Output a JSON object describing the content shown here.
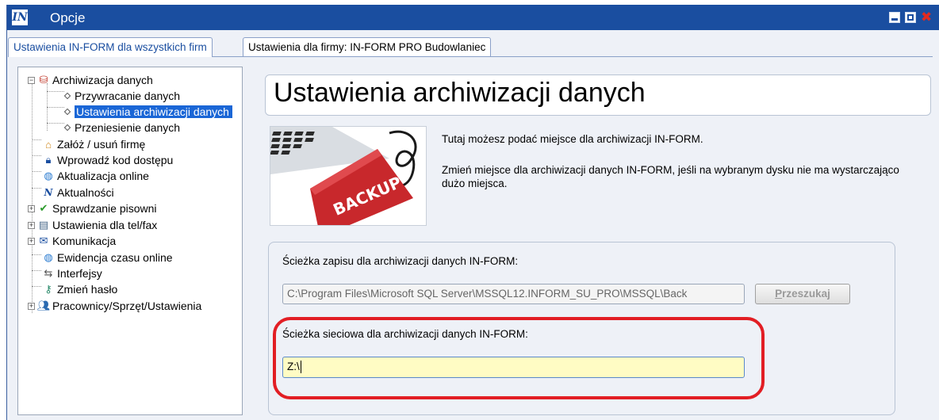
{
  "window": {
    "title": "Opcje",
    "logo_text": "IN"
  },
  "tabs": [
    {
      "label": "Ustawienia IN-FORM dla wszystkich firm",
      "active": true
    },
    {
      "label": "Ustawienia dla firmy: IN-FORM PRO Budowlaniec",
      "active": false
    }
  ],
  "tree": {
    "items": [
      {
        "label": "Archiwizacja danych",
        "icon": "archive-icon",
        "expander": "-"
      },
      {
        "label": "Przywracanie danych",
        "icon": "diamond-bullet"
      },
      {
        "label": "Ustawienia archiwizacji danych",
        "icon": "diamond-bullet",
        "selected": true
      },
      {
        "label": "Przeniesienie danych",
        "icon": "diamond-bullet"
      },
      {
        "label": "Załóż / usuń firmę",
        "icon": "house-icon"
      },
      {
        "label": "Wprowadź kod dostępu",
        "icon": "lock-icon"
      },
      {
        "label": "Aktualizacja online",
        "icon": "globe-icon"
      },
      {
        "label": "Aktualności",
        "icon": "app-logo-icon"
      },
      {
        "label": "Sprawdzanie pisowni",
        "icon": "checkmark-icon",
        "expander": "+"
      },
      {
        "label": "Ustawienia dla tel/fax",
        "icon": "fax-icon",
        "expander": "+"
      },
      {
        "label": "Komunikacja",
        "icon": "envelope-icon",
        "expander": "+"
      },
      {
        "label": "Ewidencja czasu online",
        "icon": "globe-icon"
      },
      {
        "label": "Interfejsy",
        "icon": "arrows-icon"
      },
      {
        "label": "Zmień hasło",
        "icon": "key-icon"
      },
      {
        "label": "Pracownicy/Sprzęt/Ustawienia",
        "icon": "people-icon",
        "expander": "+"
      }
    ]
  },
  "main": {
    "header_title": "Ustawienia archiwizacji danych",
    "image_label": "BACKUP",
    "info_line1": "Tutaj możesz podać miejsce dla archiwizacji IN-FORM.",
    "info_line2": "Zmień miejsce dla archiwizacji danych IN-FORM, jeśli na wybranym dysku nie ma wystarczająco dużo miejsca.",
    "path_label": "Ścieżka zapisu dla archiwizacji danych IN-FORM:",
    "path_value": "C:\\Program Files\\Microsoft SQL Server\\MSSQL12.INFORM_SU_PRO\\MSSQL\\Back",
    "search_button_first": "P",
    "search_button_rest": "rzeszukaj",
    "net_label": "Ścieżka sieciowa dla archiwizacji danych IN-FORM:",
    "net_value": "Z:\\"
  },
  "colors": {
    "titlebar": "#1a4ea0",
    "selection": "#1a66d6",
    "highlight": "#e21e24",
    "net_input_bg": "#fffcc4"
  }
}
